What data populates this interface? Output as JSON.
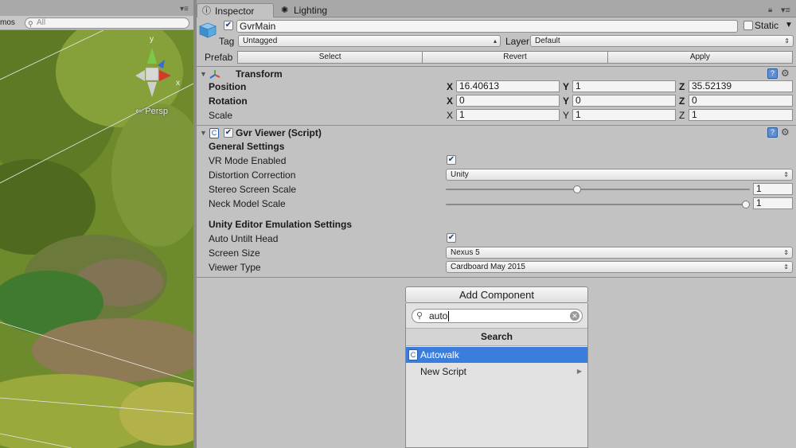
{
  "scene": {
    "gizmos_label": "mos",
    "search_placeholder": "All",
    "persp_label": "Persp",
    "gizmo_axis_y": "y",
    "gizmo_axis_x": "x"
  },
  "tabs": {
    "inspector": "Inspector",
    "lighting": "Lighting"
  },
  "gameobject": {
    "name": "GvrMain",
    "active": true,
    "static_label": "Static",
    "static_checked": false,
    "tag_label": "Tag",
    "tag_value": "Untagged",
    "layer_label": "Layer",
    "layer_value": "Default",
    "prefab_label": "Prefab",
    "prefab_select": "Select",
    "prefab_revert": "Revert",
    "prefab_apply": "Apply"
  },
  "transform": {
    "title": "Transform",
    "position_label": "Position",
    "rotation_label": "Rotation",
    "scale_label": "Scale",
    "axis_x": "X",
    "axis_y": "Y",
    "axis_z": "Z",
    "position": {
      "x": "16.40613",
      "y": "1",
      "z": "35.52139"
    },
    "rotation": {
      "x": "0",
      "y": "0",
      "z": "0"
    },
    "scale": {
      "x": "1",
      "y": "1",
      "z": "1"
    }
  },
  "gvr_viewer": {
    "title": "Gvr Viewer (Script)",
    "enabled": true,
    "general_settings": "General Settings",
    "vr_mode_label": "VR Mode Enabled",
    "vr_mode_checked": true,
    "distortion_label": "Distortion Correction",
    "distortion_value": "Unity",
    "stereo_scale_label": "Stereo Screen Scale",
    "stereo_scale_value": "1",
    "stereo_scale_fraction": 0.43,
    "neck_scale_label": "Neck Model Scale",
    "neck_scale_value": "1",
    "neck_scale_fraction": 1.0,
    "emulation_settings": "Unity Editor Emulation Settings",
    "auto_untilt_label": "Auto Untilt Head",
    "auto_untilt_checked": true,
    "screen_size_label": "Screen Size",
    "screen_size_value": "Nexus 5",
    "viewer_type_label": "Viewer Type",
    "viewer_type_value": "Cardboard May 2015"
  },
  "add_component": {
    "button_label": "Add Component",
    "search_value": "auto",
    "section_title": "Search",
    "items": [
      {
        "label": "Autowalk",
        "selected": true
      },
      {
        "label": "New Script",
        "selected": false
      }
    ]
  },
  "colors": {
    "panel_bg": "#c2c2c2",
    "selection_blue": "#3b7ddd",
    "scene_green": "#6f8a2e"
  }
}
